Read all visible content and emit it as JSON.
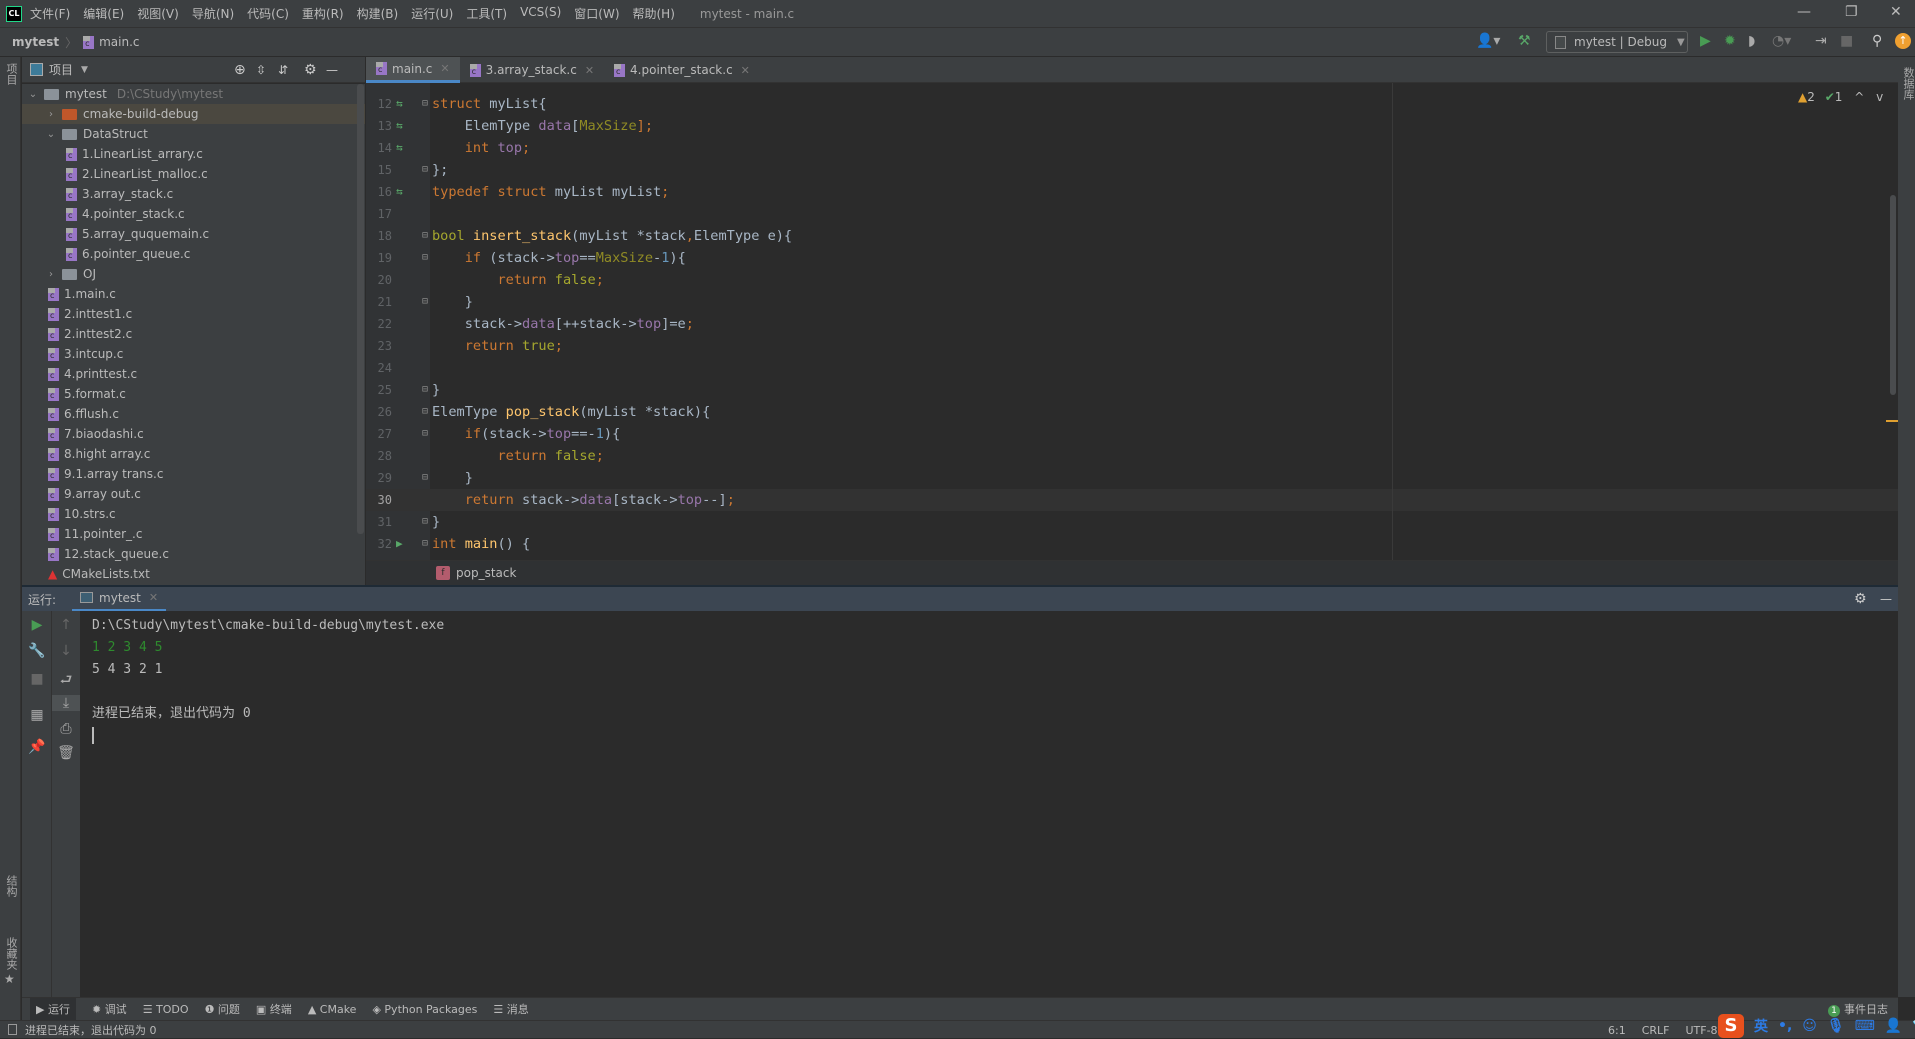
{
  "menubar": {
    "items": [
      "文件(F)",
      "编辑(E)",
      "视图(V)",
      "导航(N)",
      "代码(C)",
      "重构(R)",
      "构建(B)",
      "运行(U)",
      "工具(T)",
      "VCS(S)",
      "窗口(W)",
      "帮助(H)"
    ],
    "window_title": "mytest - main.c",
    "logo": "CL"
  },
  "navbar": {
    "project": "mytest",
    "file": "main.c",
    "run_config": "mytest | Debug"
  },
  "left_strip": {
    "project": "项目",
    "structure": "结构",
    "favorites": "收藏夹"
  },
  "right_strip": {
    "database": "数据库"
  },
  "project_panel": {
    "title": "项目",
    "tree": [
      {
        "label": "mytest",
        "path": "D:\\CStudy\\mytest",
        "type": "folder",
        "expanded": true,
        "level": 0
      },
      {
        "label": "cmake-build-debug",
        "type": "folder-excluded",
        "expanded": false,
        "level": 1,
        "selected": true
      },
      {
        "label": "DataStruct",
        "type": "folder",
        "expanded": true,
        "level": 1
      },
      {
        "label": "1.LinearList_arrary.c",
        "type": "c",
        "level": 2
      },
      {
        "label": "2.LinearList_malloc.c",
        "type": "c",
        "level": 2
      },
      {
        "label": "3.array_stack.c",
        "type": "c",
        "level": 2
      },
      {
        "label": "4.pointer_stack.c",
        "type": "c",
        "level": 2
      },
      {
        "label": "5.array_ququemain.c",
        "type": "c",
        "level": 2
      },
      {
        "label": "6.pointer_queue.c",
        "type": "c",
        "level": 2
      },
      {
        "label": "OJ",
        "type": "folder",
        "expanded": false,
        "level": 1
      },
      {
        "label": "1.main.c",
        "type": "c",
        "level": 1
      },
      {
        "label": "2.inttest1.c",
        "type": "c",
        "level": 1
      },
      {
        "label": "2.inttest2.c",
        "type": "c",
        "level": 1
      },
      {
        "label": "3.intcup.c",
        "type": "c",
        "level": 1
      },
      {
        "label": "4.printtest.c",
        "type": "c",
        "level": 1
      },
      {
        "label": "5.format.c",
        "type": "c",
        "level": 1
      },
      {
        "label": "6.fflush.c",
        "type": "c",
        "level": 1
      },
      {
        "label": "7.biaodashi.c",
        "type": "c",
        "level": 1
      },
      {
        "label": "8.hight array.c",
        "type": "c",
        "level": 1
      },
      {
        "label": "9.1.array trans.c",
        "type": "c",
        "level": 1
      },
      {
        "label": "9.array out.c",
        "type": "c",
        "level": 1
      },
      {
        "label": "10.strs.c",
        "type": "c",
        "level": 1
      },
      {
        "label": "11.pointer_.c",
        "type": "c",
        "level": 1
      },
      {
        "label": "12.stack_queue.c",
        "type": "c",
        "level": 1
      },
      {
        "label": "CMakeLists.txt",
        "type": "cmake",
        "level": 1
      }
    ]
  },
  "editor": {
    "tabs": [
      {
        "label": "main.c",
        "active": true
      },
      {
        "label": "3.array_stack.c"
      },
      {
        "label": "4.pointer_stack.c"
      }
    ],
    "inspections": {
      "warnings": "2",
      "weak_warnings": "1"
    },
    "current_line": 30,
    "lines": [
      {
        "n": "12",
        "mark": "change",
        "fold": true,
        "tokens": [
          [
            "struct ",
            "kw"
          ],
          [
            "myList",
            "id"
          ],
          [
            "{",
            "id"
          ]
        ]
      },
      {
        "n": "13",
        "mark": "change",
        "tokens": [
          [
            "    ElemType ",
            "id"
          ],
          [
            "data",
            "fld"
          ],
          [
            "[",
            "id"
          ],
          [
            "MaxSize",
            "mac"
          ],
          [
            "];",
            "kw"
          ]
        ]
      },
      {
        "n": "14",
        "mark": "change",
        "tokens": [
          [
            "    int ",
            "kw"
          ],
          [
            "top",
            "fld"
          ],
          [
            ";",
            "kw"
          ]
        ]
      },
      {
        "n": "15",
        "fold": true,
        "tokens": [
          [
            "};",
            "id"
          ]
        ]
      },
      {
        "n": "16",
        "mark": "change",
        "tokens": [
          [
            "typedef struct ",
            "kw"
          ],
          [
            "myList myList",
            "id"
          ],
          [
            ";",
            "kw"
          ]
        ]
      },
      {
        "n": "17",
        "tokens": []
      },
      {
        "n": "18",
        "fold": true,
        "tokens": [
          [
            "bool ",
            "bool"
          ],
          [
            "insert_stack",
            "fn"
          ],
          [
            "(myList *stack",
            "id"
          ],
          [
            ",",
            "kw"
          ],
          [
            "ElemType e){",
            "id"
          ]
        ]
      },
      {
        "n": "19",
        "fold": true,
        "tokens": [
          [
            "    if ",
            "kw"
          ],
          [
            "(stack->",
            "id"
          ],
          [
            "top",
            "fld"
          ],
          [
            "==",
            "id"
          ],
          [
            "MaxSize",
            "mac"
          ],
          [
            "-",
            "id"
          ],
          [
            "1",
            "num"
          ],
          [
            "){",
            "id"
          ]
        ]
      },
      {
        "n": "20",
        "tokens": [
          [
            "        return ",
            "kw"
          ],
          [
            "false",
            "bool"
          ],
          [
            ";",
            "kw"
          ]
        ]
      },
      {
        "n": "21",
        "fold": true,
        "tokens": [
          [
            "    }",
            "id"
          ]
        ]
      },
      {
        "n": "22",
        "tokens": [
          [
            "    stack->",
            "id"
          ],
          [
            "data",
            "fld"
          ],
          [
            "[++stack->",
            "id"
          ],
          [
            "top",
            "fld"
          ],
          [
            "]=e",
            "id"
          ],
          [
            ";",
            "kw"
          ]
        ]
      },
      {
        "n": "23",
        "tokens": [
          [
            "    return ",
            "kw"
          ],
          [
            "true",
            "bool"
          ],
          [
            ";",
            "kw"
          ]
        ]
      },
      {
        "n": "24",
        "tokens": []
      },
      {
        "n": "25",
        "fold": true,
        "tokens": [
          [
            "}",
            "id"
          ]
        ]
      },
      {
        "n": "26",
        "fold": true,
        "tokens": [
          [
            "ElemType ",
            "id"
          ],
          [
            "pop_stack",
            "fn"
          ],
          [
            "(myList *stack){",
            "id"
          ]
        ]
      },
      {
        "n": "27",
        "fold": true,
        "tokens": [
          [
            "    if",
            "kw"
          ],
          [
            "(stack->",
            "id"
          ],
          [
            "top",
            "fld"
          ],
          [
            "==-",
            "id"
          ],
          [
            "1",
            "num"
          ],
          [
            "){",
            "id"
          ]
        ]
      },
      {
        "n": "28",
        "tokens": [
          [
            "        return ",
            "kw"
          ],
          [
            "false",
            "bool"
          ],
          [
            ";",
            "kw"
          ]
        ]
      },
      {
        "n": "29",
        "fold": true,
        "tokens": [
          [
            "    }",
            "id"
          ]
        ]
      },
      {
        "n": "30",
        "tokens": [
          [
            "    return ",
            "kw"
          ],
          [
            "stack->",
            "id"
          ],
          [
            "data",
            "fld"
          ],
          [
            "[stack->",
            "id"
          ],
          [
            "top",
            "fld"
          ],
          [
            "--]",
            "id"
          ],
          [
            ";",
            "kw"
          ]
        ]
      },
      {
        "n": "31",
        "fold": true,
        "tokens": [
          [
            "}",
            "id"
          ]
        ]
      },
      {
        "n": "32",
        "mark": "run",
        "fold": true,
        "tokens": [
          [
            "int ",
            "kw"
          ],
          [
            "main",
            "fn"
          ],
          [
            "() {",
            "id"
          ]
        ]
      }
    ],
    "breadcrumb": {
      "badge": "f",
      "label": "pop_stack"
    }
  },
  "run_panel": {
    "label": "运行:",
    "tab": "mytest",
    "output": [
      {
        "text": "D:\\CStudy\\mytest\\cmake-build-debug\\mytest.exe",
        "color": "#bbbbbb"
      },
      {
        "text": "1 2 3 4 5",
        "color": "#2e8b2e"
      },
      {
        "text": "5 4 3 2 1",
        "color": "#bbbbbb"
      },
      {
        "text": "",
        "color": "#bbbbbb"
      },
      {
        "text": "进程已结束，退出代码为 0",
        "color": "#bbbbbb"
      }
    ]
  },
  "bottom_tools": {
    "items": [
      "运行",
      "调试",
      "TODO",
      "问题",
      "终端",
      "CMake",
      "Python Packages",
      "消息"
    ],
    "event_log": "事件日志",
    "event_count": "1"
  },
  "statusbar": {
    "message": "进程已结束，退出代码为 0",
    "position": "6:1",
    "line_sep": "CRLF",
    "encoding": "UTF-8"
  },
  "ime": {
    "logo": "S",
    "mode": "英"
  },
  "colors": {
    "accent": "#4a88c7",
    "run_green": "#499c54",
    "c_file": "#9876c6"
  }
}
